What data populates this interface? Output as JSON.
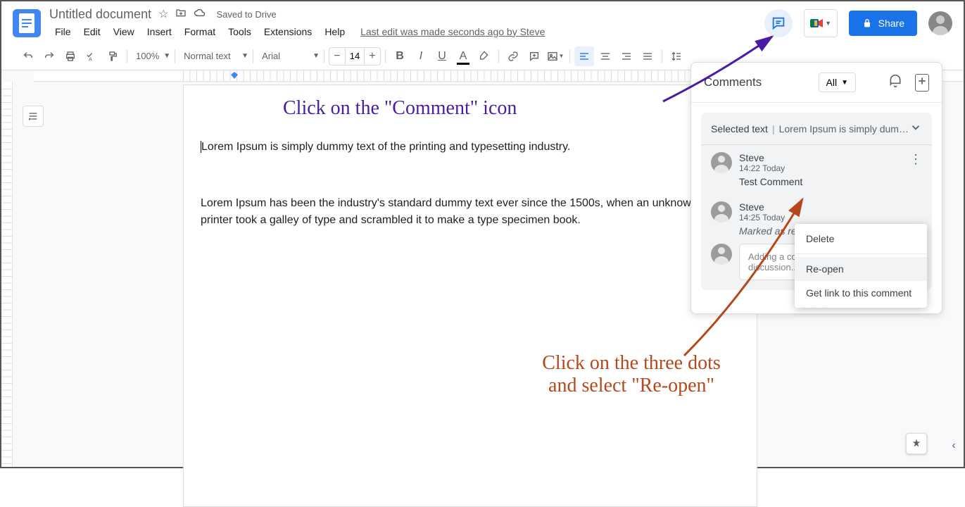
{
  "title_bar": {
    "doc_title": "Untitled document",
    "saved": "Saved to Drive",
    "last_edit": "Last edit was made seconds ago by Steve"
  },
  "menu": [
    "File",
    "Edit",
    "View",
    "Insert",
    "Format",
    "Tools",
    "Extensions",
    "Help"
  ],
  "share": "Share",
  "toolbar": {
    "zoom": "100%",
    "style": "Normal text",
    "font": "Arial",
    "size": "14"
  },
  "document": {
    "p1": "Lorem Ipsum is simply dummy text of the printing and typesetting industry.",
    "p2": "Lorem Ipsum has been the industry's standard dummy text ever since the 1500s, when an unknown printer took a galley of type and scrambled it to make a type specimen book."
  },
  "comments_panel": {
    "title": "Comments",
    "filter": "All",
    "selected_label": "Selected text",
    "selected_text": "Lorem Ipsum is simply dumm…",
    "items": [
      {
        "name": "Steve",
        "time": "14:22 Today",
        "text": "Test Comment"
      },
      {
        "name": "Steve",
        "time": "14:25 Today",
        "text": "Marked as resolved"
      }
    ],
    "reply_placeholder": "Adding a comment will re-open this discussion..."
  },
  "ctx_menu": {
    "delete": "Delete",
    "reopen": "Re-open",
    "link": "Get link to this comment"
  },
  "annotations": {
    "purple": "Click on the \"Comment\" icon",
    "red_l1": "Click on the three dots",
    "red_l2": "and select \"Re-open\""
  }
}
